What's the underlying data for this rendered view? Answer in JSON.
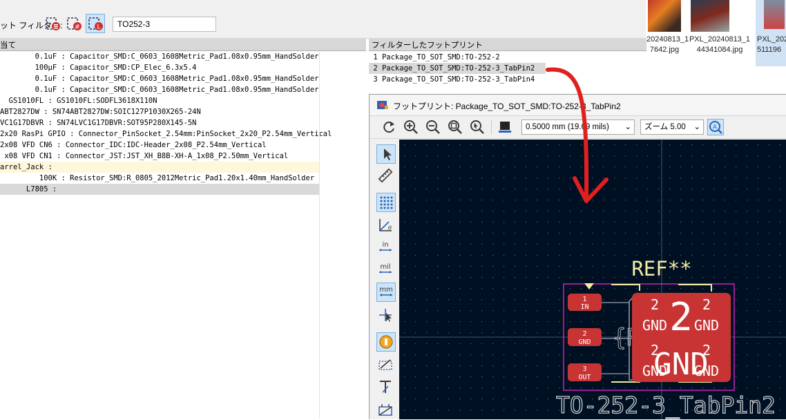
{
  "filter": {
    "label": "ット フィルター:",
    "value": "TO252-3"
  },
  "assign_header": "当て",
  "assignments": [
    {
      "text": "        0.1uF : Capacitor_SMD:C_0603_1608Metric_Pad1.08x0.95mm_HandSolder",
      "highlight": ""
    },
    {
      "text": "        100μF : Capacitor_SMD:CP_Elec_6.3x5.4",
      "highlight": ""
    },
    {
      "text": "        0.1uF : Capacitor_SMD:C_0603_1608Metric_Pad1.08x0.95mm_HandSolder",
      "highlight": ""
    },
    {
      "text": "        0.1uF : Capacitor_SMD:C_0603_1608Metric_Pad1.08x0.95mm_HandSolder",
      "highlight": ""
    },
    {
      "text": "  GS1010FL : GS1010FL:SODFL3618X110N",
      "highlight": ""
    },
    {
      "text": "ABT2827DW : SN74ABT2827DW:SOIC127P1030X265-24N",
      "highlight": ""
    },
    {
      "text": "VC1G17DBVR : SN74LVC1G17DBVR:SOT95P280X145-5N",
      "highlight": ""
    },
    {
      "text": "2x20 RasPi GPIO : Connector_PinSocket_2.54mm:PinSocket_2x20_P2.54mm_Vertical",
      "highlight": ""
    },
    {
      "text": "2x08 VFD CN6 : Connector_IDC:IDC-Header_2x08_P2.54mm_Vertical",
      "highlight": ""
    },
    {
      "text": " x08 VFD CN1 : Connector_JST:JST_XH_B8B-XH-A_1x08_P2.50mm_Vertical",
      "highlight": ""
    },
    {
      "text": "arrel_Jack :",
      "highlight": "#fdf7dc"
    },
    {
      "text": "         100K : Resistor_SMD:R_0805_2012Metric_Pad1.20x1.40mm_HandSolder",
      "highlight": ""
    },
    {
      "text": "      L7805 :",
      "highlight": "#d9d9d9"
    }
  ],
  "filtered_header": "フィルターしたフットプリント",
  "filtered": [
    {
      "text": " 1 Package_TO_SOT_SMD:TO-252-2",
      "selected": false
    },
    {
      "text": " 2 Package_TO_SOT_SMD:TO-252-3_TabPin2",
      "selected": true
    },
    {
      "text": " 3 Package_TO_SOT_SMD:TO-252-3_TabPin4",
      "selected": false
    }
  ],
  "photos": [
    {
      "line1": "20240813_1",
      "line2": "7642.jpg"
    },
    {
      "line1": "PXL_20240813_1",
      "line2": "44341084.jpg"
    },
    {
      "line1": "PXL_202",
      "line2": "511196"
    }
  ],
  "footprint_window": {
    "title": "フットプリント: Package_TO_SOT_SMD:TO-252-3_TabPin2",
    "grid_select": "0.5000 mm (19.69 mils)",
    "zoom_select": "ズーム 5.00"
  },
  "footprint": {
    "ref": "REF**",
    "ref_ghost": "{REF**}",
    "value_text": "TO-252-3_TabPin2",
    "pads": [
      {
        "num": "1",
        "net": "IN"
      },
      {
        "num": "2",
        "net": "GND"
      },
      {
        "num": "3",
        "net": "OUT"
      }
    ],
    "tab": {
      "num_big": "2",
      "net_big": "GND",
      "num_small": "2",
      "net_small": "GND"
    }
  },
  "colors": {
    "canvas_bg": "#001023",
    "pad": "#c83434",
    "silk": "#f2eda1",
    "courtyard": "#ff26e2",
    "arrow": "#e02020",
    "selection": "#cce4f7"
  }
}
